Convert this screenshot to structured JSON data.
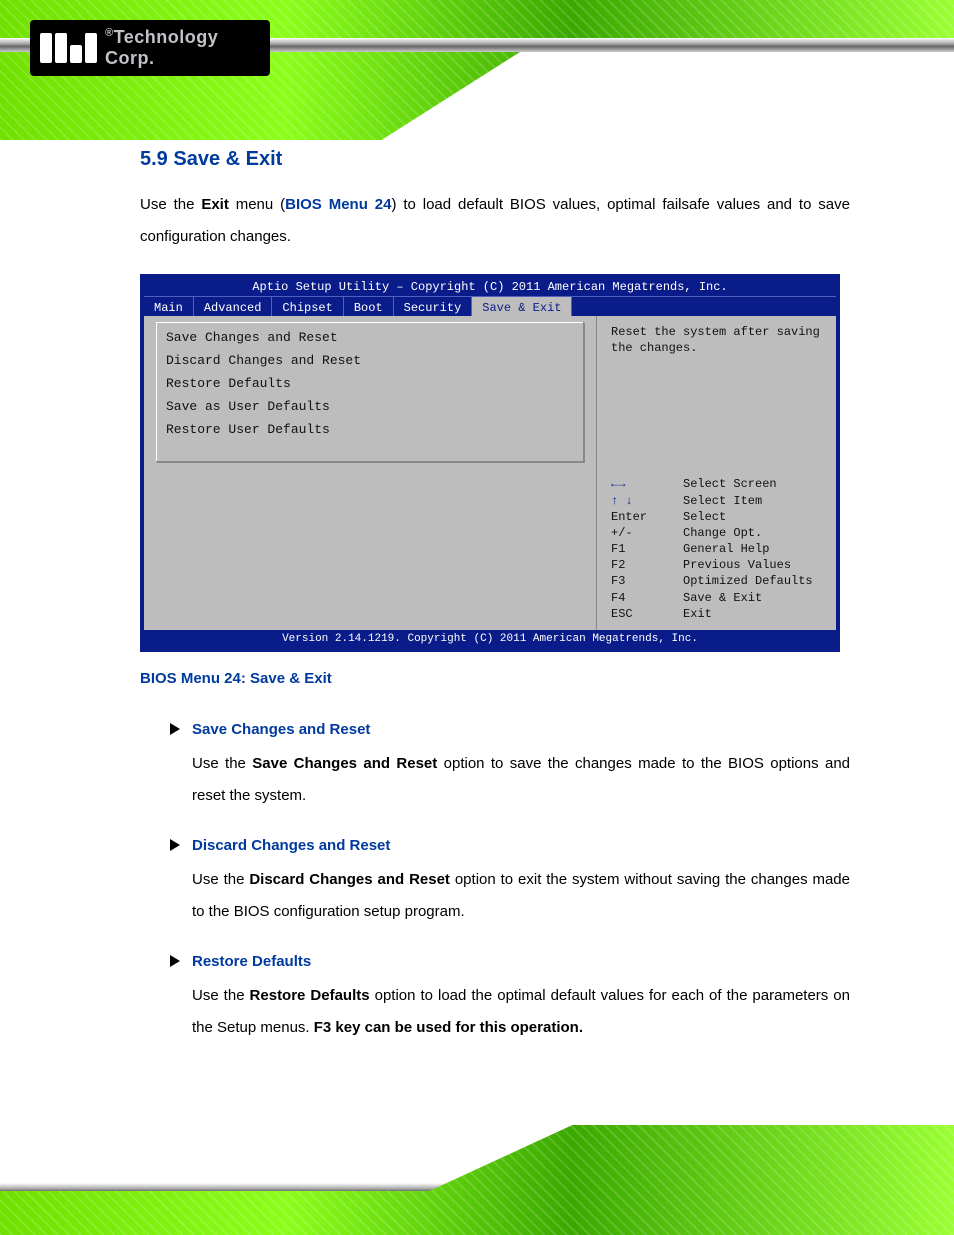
{
  "brand": {
    "logo_text": "Technology Corp.",
    "registered": "®"
  },
  "section": {
    "number": "5.9",
    "title": "Save & Exit"
  },
  "intro": {
    "pre": "Use the ",
    "bold1": "Exit",
    "mid1": " menu (",
    "ref": "BIOS Menu 24",
    "mid2": ") to load default BIOS values, optimal failsafe values and to save configuration changes."
  },
  "bios": {
    "title": "Aptio Setup Utility – Copyright (C) 2011 American Megatrends, Inc.",
    "tabs": [
      "Main",
      "Advanced",
      "Chipset",
      "Boot",
      "Security",
      "Save & Exit"
    ],
    "active_tab": 5,
    "options": [
      "Save Changes and Reset",
      "Discard Changes and Reset",
      "Restore Defaults",
      "Save as User Defaults",
      "Restore User Defaults"
    ],
    "help_desc": "Reset the system after saving the changes.",
    "nav": [
      {
        "key_sym": "←→",
        "key": "",
        "label": "Select Screen"
      },
      {
        "key_sym": "↑ ↓",
        "key": "",
        "label": "Select Item"
      },
      {
        "key_sym": "",
        "key": "Enter",
        "label": "Select"
      },
      {
        "key_sym": "",
        "key": "+/-",
        "label": "Change Opt."
      },
      {
        "key_sym": "",
        "key": "F1",
        "label": "General Help"
      },
      {
        "key_sym": "",
        "key": "F2",
        "label": "Previous Values"
      },
      {
        "key_sym": "",
        "key": "F3",
        "label": "Optimized Defaults"
      },
      {
        "key_sym": "",
        "key": "F4",
        "label": "Save & Exit"
      },
      {
        "key_sym": "",
        "key": "ESC",
        "label": "Exit"
      }
    ],
    "footer": "Version 2.14.1219. Copyright (C) 2011 American Megatrends, Inc."
  },
  "caption": "BIOS Menu 24: Save & Exit",
  "items": [
    {
      "heading": "Save Changes and Reset",
      "pre": "Use the ",
      "name": "Save Changes and Reset",
      "post": " option to save the changes made to the BIOS options and reset the system."
    },
    {
      "heading": "Discard Changes and Reset",
      "pre": "Use the ",
      "name": "Discard Changes and Reset",
      "post": " option to exit the system without saving the changes made to the BIOS configuration setup program."
    },
    {
      "heading": "Restore Defaults",
      "pre": "Use the ",
      "name": "Restore Defaults",
      "post": " option to load the optimal default values for each of the parameters on the Setup menus. ",
      "keyhint": "F3 key can be used for this operation."
    }
  ]
}
